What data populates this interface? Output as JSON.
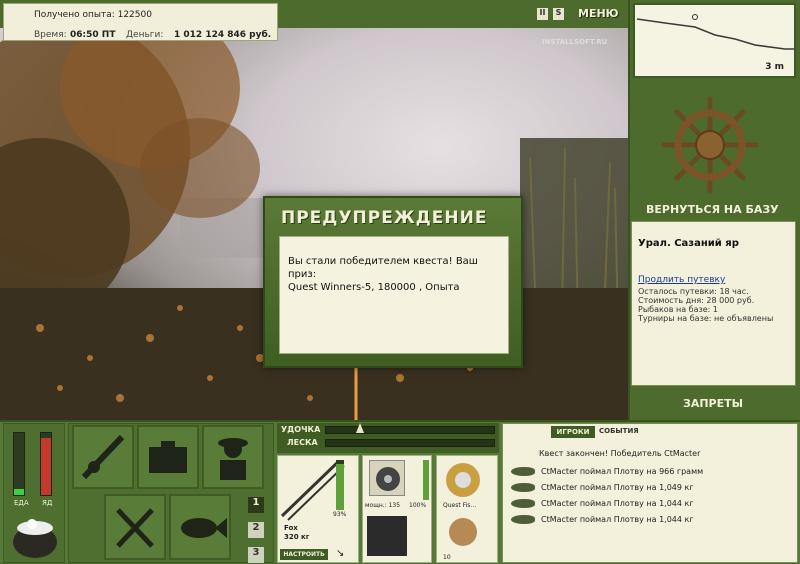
{
  "hud": {
    "xp_label": "Получено опыта: 122500",
    "time_label": "Время:",
    "time_value": "06:50 ПТ",
    "money_label": "Деньги:",
    "money_value": "1 012 124 846 руб."
  },
  "topbar": {
    "pause_label": "II",
    "speed_label": "S",
    "menu_label": "МЕНЮ",
    "watermark": "INSTALLSOFT.RU"
  },
  "depth_map": {
    "depth_label": "3 m"
  },
  "right": {
    "return_base_label": "ВЕРНУТЬСЯ НА БАЗУ",
    "place_name": "Урал. Сазаний яр",
    "extend_link": "Продлить путевку",
    "lines": [
      "Осталось путевки: 18 час.",
      "Стоимость дня: 28 000 руб.",
      "Рыбаков на базе: 1",
      "Турниры на базе: не объявлены"
    ],
    "bans_label": "ЗАПРЕТЫ"
  },
  "modal": {
    "title": "ПРЕДУПРЕЖДЕНИЕ",
    "body_line1": "Вы стали победителем квеста! Ваш приз:",
    "body_line2": "Quest Winners-5, 180000 , Опыта"
  },
  "bottom": {
    "food_label": "ЕДА",
    "poison_label": "ЯД",
    "rod_label": "УДОЧКА",
    "line_label": "ЛЕСКА",
    "rod_pct": "93%",
    "rod_name": "Fox",
    "rod_weight": "320 кг",
    "reel_label": "мощн.: 135",
    "reel_pct": "100%",
    "line_name": "Quest Fis...",
    "bait_count": "10",
    "setup_button": "НАСТРОИТЬ",
    "pages": [
      "1",
      "2",
      "3"
    ],
    "tab_players": "ИГРОКИ",
    "tab_events": "СОБЫТИЯ",
    "events_title": "Квест закончен! Победитель CtMacter",
    "events": [
      "CtMacter поймал Плотву на 966 грамм",
      "CtMacter поймал Плотву на 1,049 кг",
      "CtMacter поймал Плотву на 1,044 кг",
      "CtMacter поймал Плотву на 1,044 кг"
    ]
  },
  "colors": {
    "panel": "#4c6b2d",
    "cream": "#f3f0dc",
    "accent": "#f2f0d8"
  }
}
